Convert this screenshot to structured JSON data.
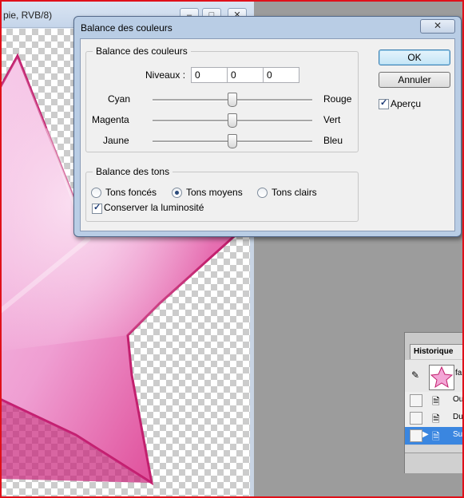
{
  "document": {
    "title": "pie, RVB/8)",
    "win_min": "–",
    "win_max": "□",
    "win_close": "✕"
  },
  "dialog": {
    "title": "Balance des couleurs",
    "close": "✕",
    "color_balance": {
      "legend": "Balance des couleurs",
      "levels_label": "Niveaux :",
      "levels": [
        "0",
        "0",
        "0"
      ],
      "sliders": [
        {
          "left": "Cyan",
          "right": "Rouge",
          "value": 0
        },
        {
          "left": "Magenta",
          "right": "Vert",
          "value": 0
        },
        {
          "left": "Jaune",
          "right": "Bleu",
          "value": 0
        }
      ]
    },
    "tone_balance": {
      "legend": "Balance des tons",
      "options": [
        "Tons foncés",
        "Tons moyens",
        "Tons clairs"
      ],
      "selected": "Tons moyens",
      "preserve_luminosity": "Conserver la luminosité",
      "preserve_checked": true
    },
    "buttons": {
      "ok": "OK",
      "cancel": "Annuler"
    },
    "preview": {
      "label": "Aperçu",
      "checked": true
    }
  },
  "history": {
    "tab": "Historique",
    "snapshot_label": "fa",
    "items": [
      {
        "label": "Ou",
        "selected": false
      },
      {
        "label": "Du",
        "selected": false
      },
      {
        "label": "Su",
        "selected": true
      }
    ]
  }
}
